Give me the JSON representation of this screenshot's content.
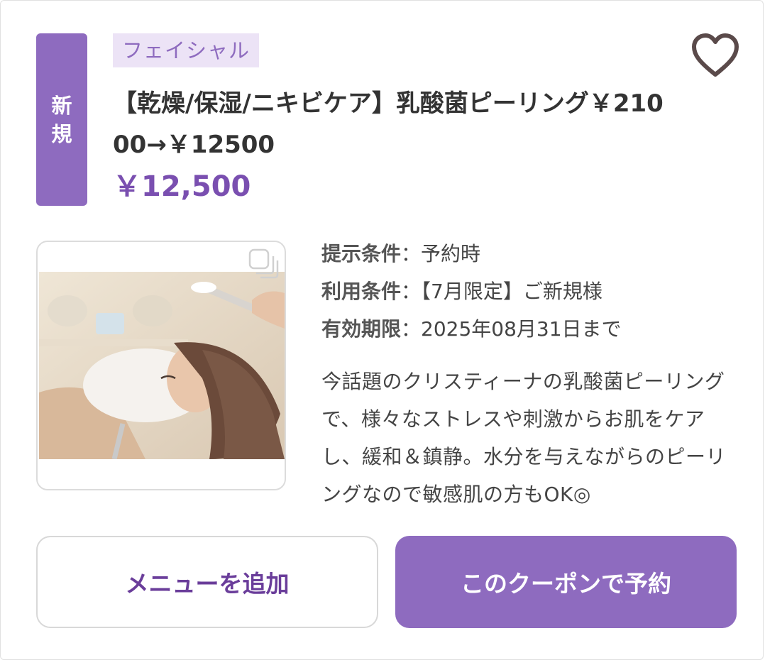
{
  "coupon": {
    "badge_line1": "新",
    "badge_line2": "規",
    "category": "フェイシャル",
    "title": "【乾燥/保湿/ニキビケア】乳酸菌ピーリング￥21000→￥12500",
    "price": "￥12,500",
    "favorite_icon": "heart-outline-icon",
    "gallery_icon": "stacked-photos-icon",
    "conditions": [
      {
        "label": "提示条件",
        "value": "予約時"
      },
      {
        "label": "利用条件",
        "value": "【7月限定】ご新規様"
      },
      {
        "label": "有効期限",
        "value": "2025年08月31日まで"
      }
    ],
    "separator": "：",
    "description": "今話題のクリスティーナの乳酸菌ピーリングで、様々なストレスや刺激からお肌をケアし、緩和＆鎮静。水分を与えながらのピーリングなので敏感肌の方もOK◎",
    "buttons": {
      "add_menu": "メニューを追加",
      "reserve": "このクーポンで予約"
    }
  },
  "colors": {
    "accent": "#8e6bbf",
    "accent_dark": "#7a4fb0",
    "tag_bg": "#ece3f6",
    "text": "#333333",
    "icon": "#5a4a4a"
  }
}
